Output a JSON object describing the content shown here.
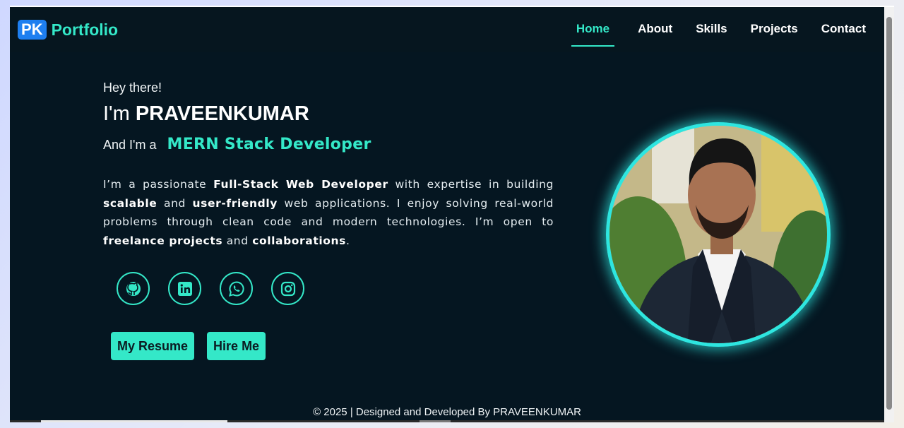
{
  "brand": {
    "badge": "PK",
    "name": "Portfolio"
  },
  "nav": {
    "items": [
      {
        "label": "Home",
        "active": true
      },
      {
        "label": "About"
      },
      {
        "label": "Skills"
      },
      {
        "label": "Projects"
      },
      {
        "label": "Contact"
      }
    ]
  },
  "hero": {
    "greeting": "Hey there!",
    "name_prefix": "I'm",
    "name": "PRAVEENKUMAR",
    "role_prefix": "And I'm a",
    "role": "MERN Stack Developer",
    "bio": {
      "p1": "I’m a passionate",
      "b1": "Full-Stack Web Developer",
      "p2": "with expertise in building",
      "b2": "scalable",
      "p3": "and",
      "b3": "user-friendly",
      "p4": "web applications. I enjoy solving real-world problems through clean code and modern technologies. I’m open to",
      "b4": "freelance projects",
      "p5": "and",
      "b5": "collaborations",
      "p6": "."
    }
  },
  "socials": [
    {
      "icon": "github-icon"
    },
    {
      "icon": "linkedin-icon"
    },
    {
      "icon": "whatsapp-icon"
    },
    {
      "icon": "instagram-icon"
    }
  ],
  "buttons": {
    "resume": "My Resume",
    "hire": "Hire Me"
  },
  "footer": {
    "text": "© 2025 | Designed and Developed By PRAVEENKUMAR"
  },
  "colors": {
    "accent": "#34e8c8",
    "background": "#051621",
    "brand_badge": "#1e7ff0",
    "avatar_ring": "#2ee6e0"
  }
}
